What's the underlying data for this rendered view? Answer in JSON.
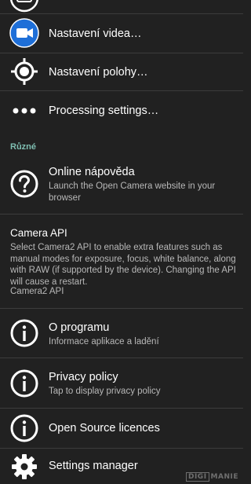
{
  "colors": {
    "background": "#212121",
    "divider": "#3c3c3c",
    "category": "#7fbfb2",
    "video_icon_circle": "#1e6fd8",
    "summary_text": "#b8b8b8"
  },
  "settings": {
    "video": {
      "title": "Nastavení videa…",
      "icon": "video-camera-icon"
    },
    "location": {
      "title": "Nastavení polohy…",
      "icon": "gps-location-icon"
    },
    "processing": {
      "title": "Processing settings…",
      "icon": "more-dots-icon"
    },
    "category_misc": "Různé",
    "online_help": {
      "title": "Online nápověda",
      "summary": "Launch the Open Camera website in your browser",
      "icon": "help-icon"
    },
    "camera_api": {
      "title": "Camera API",
      "summary": "Select Camera2 API to enable extra features such as manual modes for exposure, focus, white balance, along with RAW (if supported by the device). Changing the API will cause a restart.",
      "value": "Camera2 API"
    },
    "about": {
      "title": "O programu",
      "summary": "Informace aplikace a ladění",
      "icon": "info-icon"
    },
    "privacy": {
      "title": "Privacy policy",
      "summary": "Tap to display privacy policy",
      "icon": "info-icon"
    },
    "licences": {
      "title": "Open Source licences",
      "icon": "info-icon"
    },
    "settings_manager": {
      "title": "Settings manager",
      "icon": "gear-icon"
    }
  },
  "watermark": {
    "left": "DIGI",
    "right": "MANIE"
  }
}
